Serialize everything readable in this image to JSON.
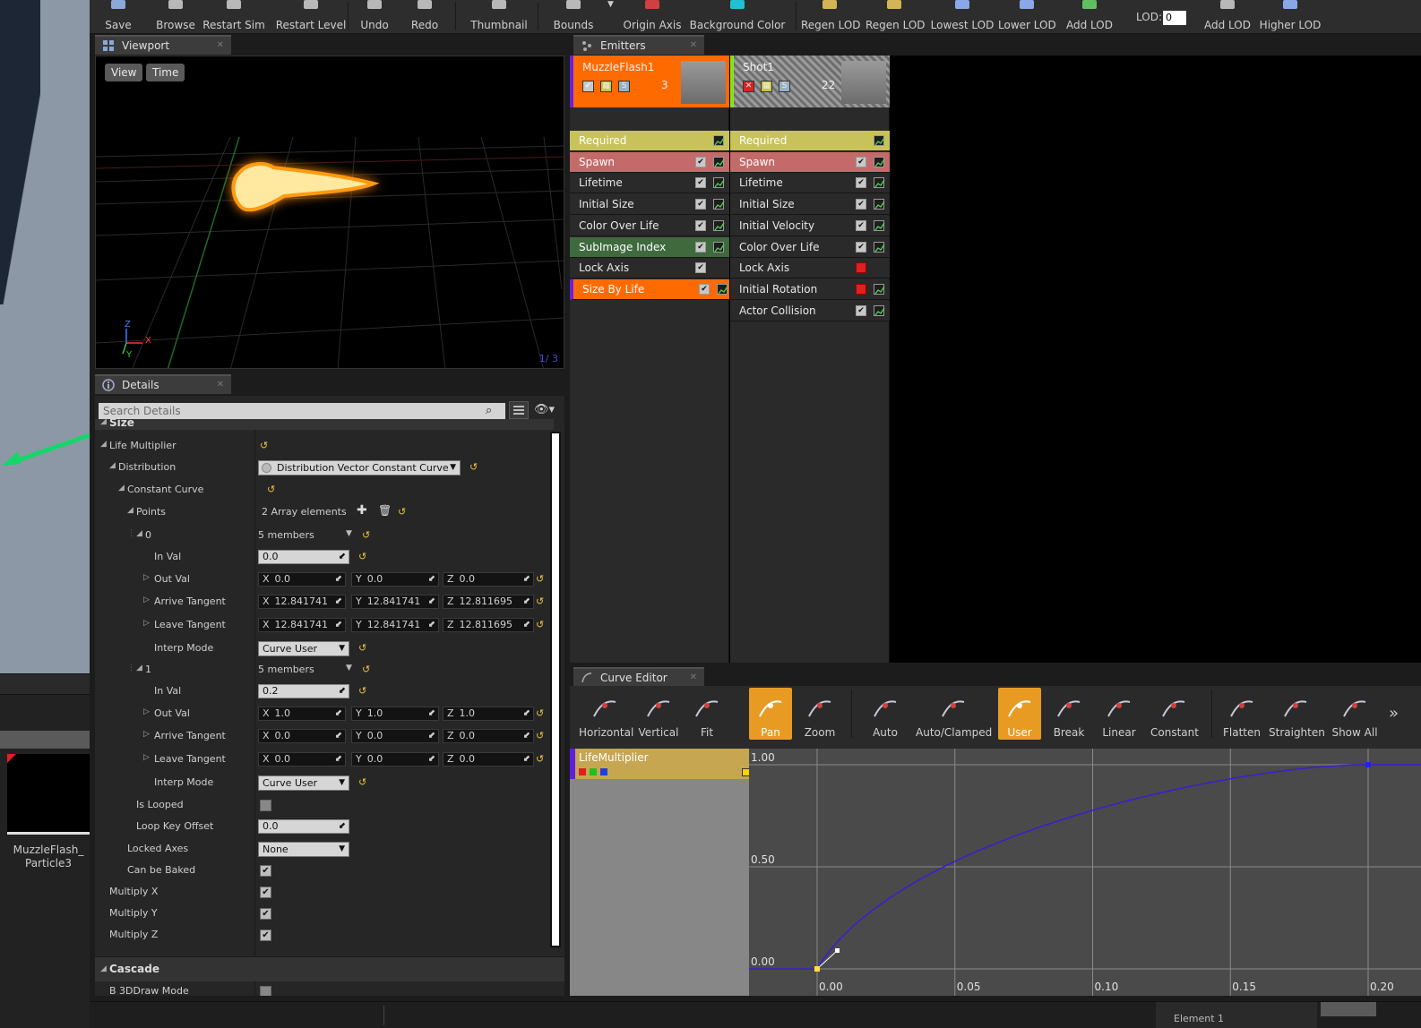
{
  "toolbar": {
    "buttons": [
      {
        "label": "Save",
        "icon": "save-icon"
      },
      {
        "label": "Browse",
        "icon": "browse-icon"
      },
      {
        "label": "Restart Sim",
        "icon": "restart-sim-icon"
      },
      {
        "label": "Restart Level",
        "icon": "restart-level-icon"
      },
      {
        "label": "Undo",
        "icon": "undo-icon"
      },
      {
        "label": "Redo",
        "icon": "redo-icon"
      },
      {
        "label": "Thumbnail",
        "icon": "thumbnail-icon"
      },
      {
        "label": "Bounds",
        "icon": "bounds-icon"
      },
      {
        "label": "Origin Axis",
        "icon": "origin-axis-icon"
      },
      {
        "label": "Background Color",
        "icon": "background-color-icon"
      },
      {
        "label": "Regen LOD",
        "icon": "regen-lod-icon"
      },
      {
        "label": "Regen LOD",
        "icon": "regen-lod-icon"
      },
      {
        "label": "Lowest LOD",
        "icon": "lowest-lod-icon"
      },
      {
        "label": "Lower LOD",
        "icon": "lower-lod-icon"
      },
      {
        "label": "Add LOD",
        "icon": "add-lod-icon"
      },
      {
        "label": "Add LOD",
        "icon": "add-lod-icon"
      },
      {
        "label": "Higher LOD",
        "icon": "higher-lod-icon"
      }
    ],
    "lod_label": "LOD:",
    "lod_value": "0"
  },
  "viewport": {
    "tab_label": "Viewport",
    "view_button": "View",
    "time_button": "Time",
    "frame_counter": "1/ 3",
    "axis_labels": {
      "z": "Z",
      "x": "X",
      "y": "Y"
    }
  },
  "details": {
    "tab_label": "Details",
    "search_placeholder": "Search Details",
    "section_size": "Size",
    "section_cascade": "Cascade",
    "rows": {
      "life_multiplier": "Life Multiplier",
      "distribution": "Distribution",
      "distribution_value": "Distribution Vector Constant Curve",
      "constant_curve": "Constant Curve",
      "points": "Points",
      "points_value": "2 Array elements",
      "p0": "0",
      "p0_members": "5 members",
      "p0_in_val_label": "In Val",
      "p0_in_val": "0.0",
      "p0_out_val_label": "Out Val",
      "p0_out_val": {
        "x": "0.0",
        "y": "0.0",
        "z": "0.0"
      },
      "p0_arrive_label": "Arrive Tangent",
      "p0_arrive": {
        "x": "12.841741",
        "y": "12.841741",
        "z": "12.811695"
      },
      "p0_leave_label": "Leave Tangent",
      "p0_leave": {
        "x": "12.841741",
        "y": "12.841741",
        "z": "12.811695"
      },
      "p0_interp_label": "Interp Mode",
      "p0_interp": "Curve User",
      "p1": "1",
      "p1_members": "5 members",
      "p1_in_val_label": "In Val",
      "p1_in_val": "0.2",
      "p1_out_val_label": "Out Val",
      "p1_out_val": {
        "x": "1.0",
        "y": "1.0",
        "z": "1.0"
      },
      "p1_arrive_label": "Arrive Tangent",
      "p1_arrive": {
        "x": "0.0",
        "y": "0.0",
        "z": "0.0"
      },
      "p1_leave_label": "Leave Tangent",
      "p1_leave": {
        "x": "0.0",
        "y": "0.0",
        "z": "0.0"
      },
      "p1_interp_label": "Interp Mode",
      "p1_interp": "Curve User",
      "is_looped": "Is Looped",
      "loop_key_offset": "Loop Key Offset",
      "loop_key_offset_value": "0.0",
      "locked_axes": "Locked Axes",
      "locked_axes_value": "None",
      "can_be_baked": "Can be Baked",
      "multiply_x": "Multiply X",
      "multiply_y": "Multiply Y",
      "multiply_z": "Multiply Z",
      "b3d_draw_mode": "B 3DDraw Mode"
    },
    "axis_x": "X",
    "axis_y": "Y",
    "axis_z": "Z"
  },
  "emitters": {
    "tab_label": "Emitters",
    "columns": [
      {
        "name": "MuzzleFlash1",
        "count": "3",
        "header_color": "#ff6a00",
        "modules": [
          {
            "label": "Required",
            "style": "required",
            "check": "none",
            "graph": true
          },
          {
            "label": "Spawn",
            "style": "spawn",
            "check": "on",
            "graph": true
          },
          {
            "label": "Lifetime",
            "style": "normal",
            "check": "on",
            "graph": true
          },
          {
            "label": "Initial Size",
            "style": "normal",
            "check": "on",
            "graph": true
          },
          {
            "label": "Color Over Life",
            "style": "normal",
            "check": "on",
            "graph": true
          },
          {
            "label": "SubImage Index",
            "style": "green",
            "check": "on",
            "graph": true
          },
          {
            "label": "Lock Axis",
            "style": "normal",
            "check": "on",
            "graph": false
          },
          {
            "label": "Size By Life",
            "style": "selected",
            "check": "on",
            "graph": true
          }
        ]
      },
      {
        "name": "Shot1",
        "count": "22",
        "header_color": "#8a8a8a",
        "modules": [
          {
            "label": "Required",
            "style": "required",
            "check": "none",
            "graph": true
          },
          {
            "label": "Spawn",
            "style": "spawn",
            "check": "on",
            "graph": true
          },
          {
            "label": "Lifetime",
            "style": "normal",
            "check": "on",
            "graph": true
          },
          {
            "label": "Initial Size",
            "style": "normal",
            "check": "on",
            "graph": true
          },
          {
            "label": "Initial Velocity",
            "style": "normal",
            "check": "on",
            "graph": true
          },
          {
            "label": "Color Over Life",
            "style": "normal",
            "check": "on",
            "graph": true
          },
          {
            "label": "Lock Axis",
            "style": "normal",
            "check": "off",
            "graph": false
          },
          {
            "label": "Initial Rotation",
            "style": "normal",
            "check": "off",
            "graph": true
          },
          {
            "label": "Actor Collision",
            "style": "normal",
            "check": "on",
            "graph": true
          }
        ]
      }
    ]
  },
  "curve_editor": {
    "tab_label": "Curve Editor",
    "buttons": [
      {
        "label": "Horizontal",
        "icon": "fit-horizontal-icon",
        "active": false
      },
      {
        "label": "Vertical",
        "icon": "fit-vertical-icon",
        "active": false
      },
      {
        "label": "Fit",
        "icon": "fit-icon",
        "active": false
      },
      {
        "label": "Pan",
        "icon": "pan-icon",
        "active": true
      },
      {
        "label": "Zoom",
        "icon": "zoom-icon",
        "active": false
      },
      {
        "label": "Auto",
        "icon": "auto-tangent-icon",
        "active": false
      },
      {
        "label": "Auto/Clamped",
        "icon": "auto-clamped-icon",
        "active": false
      },
      {
        "label": "User",
        "icon": "user-tangent-icon",
        "active": true
      },
      {
        "label": "Break",
        "icon": "break-tangent-icon",
        "active": false
      },
      {
        "label": "Linear",
        "icon": "linear-icon",
        "active": false
      },
      {
        "label": "Constant",
        "icon": "constant-icon",
        "active": false
      },
      {
        "label": "Flatten",
        "icon": "flatten-icon",
        "active": false
      },
      {
        "label": "Straighten",
        "icon": "straighten-icon",
        "active": false
      },
      {
        "label": "Show All",
        "icon": "show-all-icon",
        "active": false
      }
    ],
    "track_name": "LifeMultiplier",
    "y_ticks": [
      "1.00",
      "0.50",
      "0.00"
    ],
    "x_ticks": [
      "0.00",
      "0.05",
      "0.10",
      "0.15",
      "0.20"
    ],
    "curve_color": "#3a1fd0"
  },
  "asset": {
    "label": "MuzzleFlash_\nParticle3"
  },
  "status": {
    "element_label": "Element 1"
  }
}
